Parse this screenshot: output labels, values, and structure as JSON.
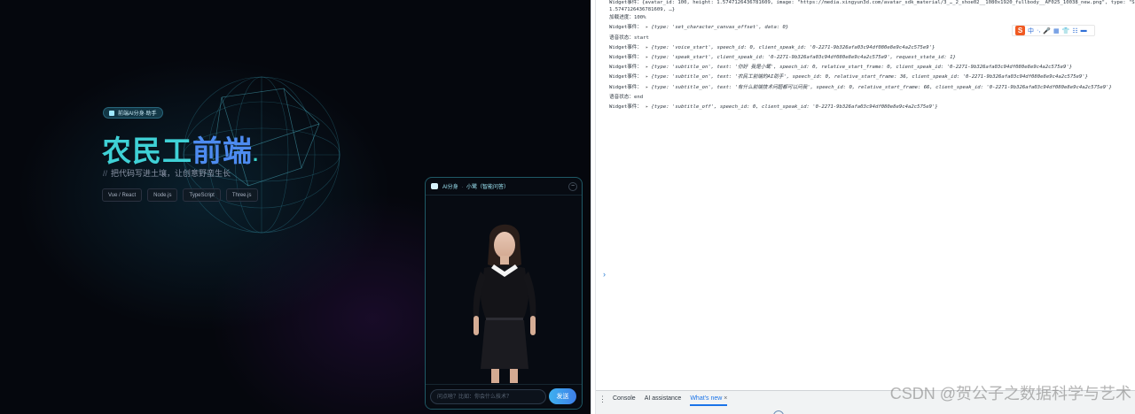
{
  "page": {
    "badge": "前端AI分身·助手",
    "title_part1": "农民工",
    "title_part2": "前端",
    "title_dot": ".",
    "slogan_prefix": "//",
    "slogan": "把代码写进土壤，让创意野蛮生长",
    "tags": [
      "Vue / React",
      "Node.js",
      "TypeScript",
      "Three.js"
    ]
  },
  "chat": {
    "title_left": "AI分身",
    "title_sep": "·",
    "title_right": "小鹭（智能问答）",
    "close_icon": "−",
    "input_placeholder": "问点啥？比如：你会什么技术？",
    "send_label": "发送"
  },
  "console": {
    "log": [
      {
        "kind": "text",
        "label": "Widget事件：",
        "payload": "{avatar_id: 100, height: 1.5747126436781609, image: \"https://media.xingyun3d.com/avatar_sdk_material/3_…_2_shoe02__1080x1920_fullbody__AF025_10038_new.png\", type: \"SetCharacterCan"
      },
      {
        "kind": "text",
        "label": "",
        "payload": "1.5747126436781609, …}"
      },
      {
        "kind": "text",
        "label": "加载进度：",
        "payload": "100%"
      },
      {
        "kind": "obj",
        "label": "Widget事件：",
        "payload": "{type: 'set_character_canvas_offset', data: 0}"
      },
      {
        "kind": "text",
        "label": "语音状态：",
        "payload": "start"
      },
      {
        "kind": "obj",
        "label": "Widget事件：",
        "payload": "{type: 'voice_start', speech_id: 0, client_speak_id: '0-2271-9b326afa03c94df080e8e9c4a2c575e9'}"
      },
      {
        "kind": "obj",
        "label": "Widget事件：",
        "payload": "{type: 'speak_start', client_speak_id: '0-2271-9b326afa03c94df080e8e9c4a2c575e9', request_state_id: 1}"
      },
      {
        "kind": "obj",
        "label": "Widget事件：",
        "payload": "{type: 'subtitle_on', text: '你好 我是小鹭', speech_id: 0, relative_start_frame: 0, client_speak_id: '0-2271-9b326afa03c94df080e8e9c4a2c575e9'}"
      },
      {
        "kind": "obj",
        "label": "Widget事件：",
        "payload": "{type: 'subtitle_on', text: '农民工前端的AI助手', speech_id: 0, relative_start_frame: 36, client_speak_id: '0-2271-9b326afa03c94df080e8e9c4a2c575e9'}"
      },
      {
        "kind": "obj",
        "label": "Widget事件：",
        "payload": "{type: 'subtitle_on', text: '有什么前端技术问题都可以问我', speech_id: 0, relative_start_frame: 66, client_speak_id: '0-2271-9b326afa03c94df080e8e9c4a2c575e9'}"
      },
      {
        "kind": "text",
        "label": "语音状态：",
        "payload": "end"
      },
      {
        "kind": "obj",
        "label": "Widget事件：",
        "payload": "{type: 'subtitle_off', speech_id: 0, client_speak_id: '0-2271-9b326afa03c94df080e8e9c4a2c575e9'}"
      }
    ],
    "prompt": "›",
    "ime": {
      "logo": "S",
      "items": [
        "中",
        "·,",
        "🎤",
        "▦",
        "👕",
        "☷",
        "▬"
      ]
    }
  },
  "drawer": {
    "menu_icon": "⋮",
    "tabs": [
      {
        "label": "Console",
        "active": false
      },
      {
        "label": "AI assistance",
        "active": false
      },
      {
        "label": "What's new",
        "active": true
      }
    ],
    "close_icon": "×"
  },
  "watermark": "CSDN @贺公子之数据科学与艺术"
}
